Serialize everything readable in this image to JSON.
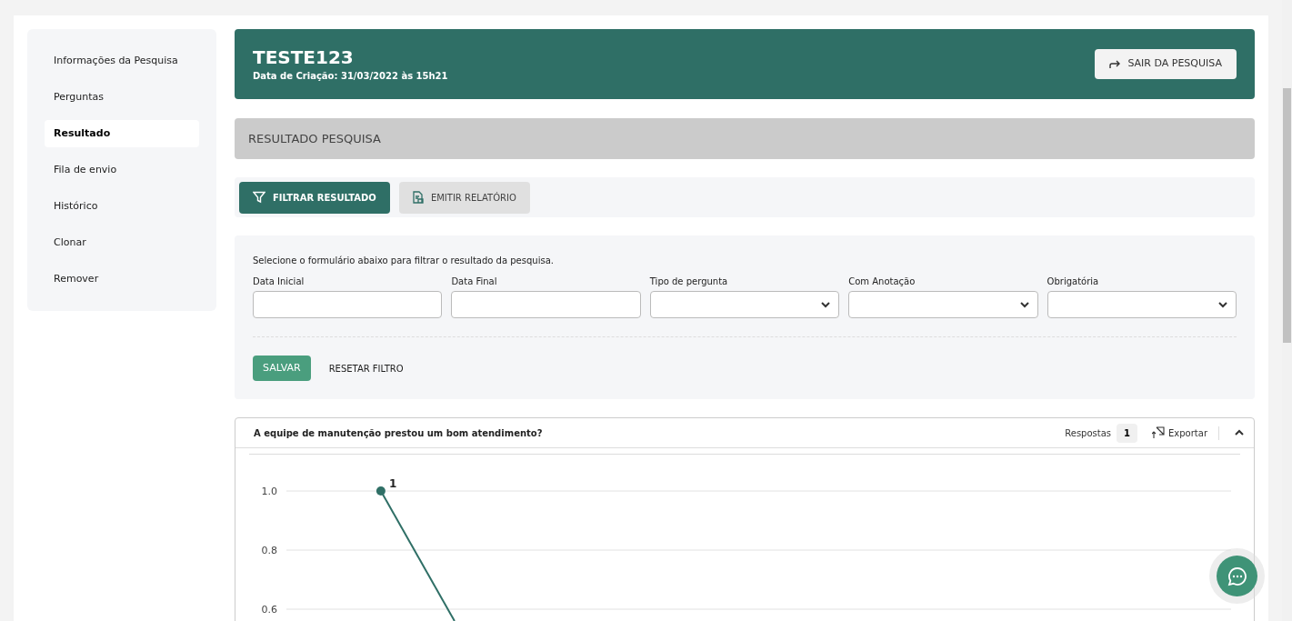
{
  "sidebar": {
    "items": [
      {
        "label": "Informações da Pesquisa",
        "selected": false
      },
      {
        "label": "Perguntas",
        "selected": false
      },
      {
        "label": "Resultado",
        "selected": true
      },
      {
        "label": "Fila de envio",
        "selected": false
      },
      {
        "label": "Histórico",
        "selected": false
      },
      {
        "label": "Clonar",
        "selected": false
      },
      {
        "label": "Remover",
        "selected": false
      }
    ]
  },
  "header": {
    "title": "TESTE123",
    "subtitle": "Data de Criação: 31/03/2022 às 15h21",
    "exit_button": "SAIR DA PESQUISA"
  },
  "section_title": "RESULTADO PESQUISA",
  "tabs": [
    {
      "label": "FILTRAR RESULTADO",
      "selected": true
    },
    {
      "label": "EMITIR RELATÓRIO",
      "selected": false
    }
  ],
  "filter": {
    "hint": "Selecione o formulário abaixo para filtrar o resultado da pesquisa.",
    "fields": [
      {
        "label": "Data Inicial",
        "kind": "input"
      },
      {
        "label": "Data Final",
        "kind": "input"
      },
      {
        "label": "Tipo de pergunta",
        "kind": "select"
      },
      {
        "label": "Com Anotação",
        "kind": "select"
      },
      {
        "label": "Obrigatória",
        "kind": "select"
      }
    ],
    "save_button": "SALVAR",
    "reset_button": "RESETAR FILTRO"
  },
  "question": {
    "title": "A equipe de manutenção prestou um bom atendimento?",
    "responses_label": "Respostas",
    "responses_count": "1",
    "export_button": "Exportar",
    "chart_data": {
      "type": "line",
      "categories": [
        null,
        null,
        null,
        null,
        null
      ],
      "ylim": [
        0.6,
        1
      ],
      "series": [
        {
          "color": "#2f6f66",
          "marker": "circle",
          "values": [
            1,
            null,
            null,
            null,
            null
          ]
        }
      ],
      "yticks": [
        {
          "value": 1,
          "label": "1.0"
        },
        {
          "value": 0.8,
          "label": "0.8"
        },
        {
          "value": 0.6,
          "label": "0.6"
        }
      ],
      "data_labels": true
    }
  }
}
